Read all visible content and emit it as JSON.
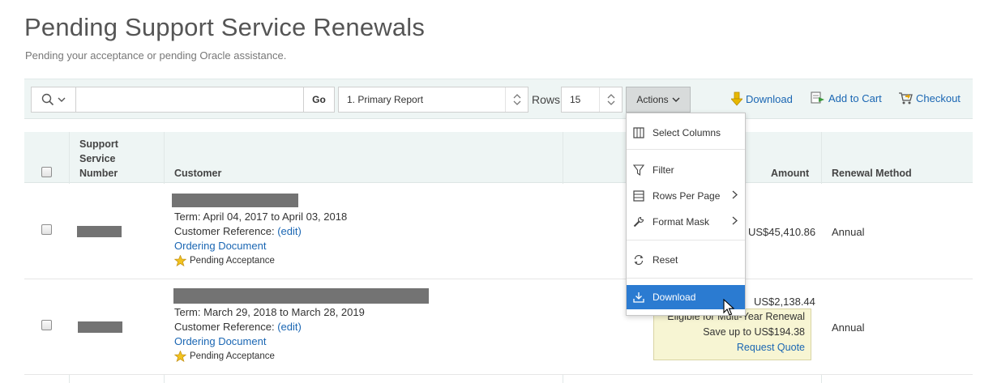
{
  "page": {
    "title": "Pending Support Service Renewals",
    "subtitle": "Pending your acceptance or pending Oracle assistance."
  },
  "toolbar": {
    "search_placeholder": "",
    "go_label": "Go",
    "report_select": "1. Primary Report",
    "rows_label": "Rows",
    "rows_value": "15",
    "actions_label": "Actions",
    "download_label": "Download",
    "add_to_cart_label": "Add to Cart",
    "checkout_label": "Checkout"
  },
  "table": {
    "headers": {
      "support_service_number": "Support Service Number",
      "support_service_lines": [
        "Support",
        "Service",
        "Number"
      ],
      "customer": "Customer",
      "amount": "Amount",
      "renewal_method": "Renewal Method"
    },
    "rows": [
      {
        "term": "Term: April 04, 2017 to April 03, 2018",
        "customer_reference_label": "Customer Reference:",
        "edit_label": "(edit)",
        "ordering_document": "Ordering Document",
        "status": "Pending Acceptance",
        "amount": "US$45,410.86",
        "renewal_method": "Annual"
      },
      {
        "term": "Term: March 29, 2018 to March 28, 2019",
        "customer_reference_label": "Customer Reference:",
        "edit_label": "(edit)",
        "ordering_document": "Ordering Document",
        "status": "Pending Acceptance",
        "amount": "US$2,138.44",
        "renewal_method": "Annual"
      }
    ]
  },
  "tooltip": {
    "line1": "Eligible for Multi-Year Renewal",
    "line2": "Save up to US$194.38",
    "link": "Request Quote"
  },
  "actions_menu": {
    "items": [
      {
        "label": "Select Columns",
        "icon": "columns-icon"
      },
      {
        "label": "Filter",
        "icon": "filter-icon"
      },
      {
        "label": "Rows Per Page",
        "icon": "rows-icon",
        "submenu": true
      },
      {
        "label": "Format Mask",
        "icon": "wrench-icon",
        "submenu": true
      },
      {
        "label": "Reset",
        "icon": "reset-icon"
      },
      {
        "label": "Download",
        "icon": "download-icon",
        "active": true
      }
    ]
  },
  "colors": {
    "toolbar_bg": "#eef5f4",
    "link": "#1a66b3",
    "menu_active": "#2b7bd1",
    "tooltip_bg": "#f7f5d3"
  }
}
